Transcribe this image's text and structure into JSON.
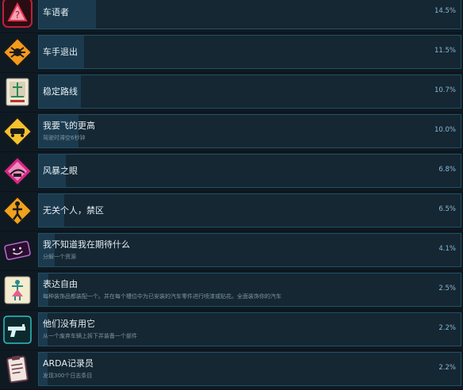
{
  "achievements": [
    {
      "icon": "question-sign-icon",
      "title": "车语者",
      "desc": "",
      "percent": "14.5%",
      "fraction": 0.145
    },
    {
      "icon": "spider-sign-icon",
      "title": "车手退出",
      "desc": "",
      "percent": "11.5%",
      "fraction": 0.115
    },
    {
      "icon": "road-card-icon",
      "title": "稳定路线",
      "desc": "",
      "percent": "10.7%",
      "fraction": 0.107
    },
    {
      "icon": "flying-car-sign-icon",
      "title": "我要飞的更高",
      "desc": "驾驶时滞空6秒钟",
      "percent": "10.0%",
      "fraction": 0.1
    },
    {
      "icon": "storm-eye-sign-icon",
      "title": "风暴之眼",
      "desc": "",
      "percent": "6.8%",
      "fraction": 0.068
    },
    {
      "icon": "no-entry-sign-icon",
      "title": "无关个人，禁区",
      "desc": "",
      "percent": "6.5%",
      "fraction": 0.065
    },
    {
      "icon": "smiley-ticket-icon",
      "title": "我不知道我在期待什么",
      "desc": "分解一个资源",
      "percent": "4.1%",
      "fraction": 0.041
    },
    {
      "icon": "dancer-card-icon",
      "title": "表达自由",
      "desc": "每种装饰品都装配一个。并在每个槽位中为已安装的汽车零件进行喷漆或贴花。全面装饰你的汽车",
      "percent": "2.5%",
      "fraction": 0.025
    },
    {
      "icon": "gun-card-icon",
      "title": "他们没有用它",
      "desc": "从一个废弃车辆上拆下并装备一个部件",
      "percent": "2.2%",
      "fraction": 0.022
    },
    {
      "icon": "clipboard-icon",
      "title": "ARDA记录员",
      "desc": "发现300个日志条目",
      "percent": "2.2%",
      "fraction": 0.022
    }
  ]
}
